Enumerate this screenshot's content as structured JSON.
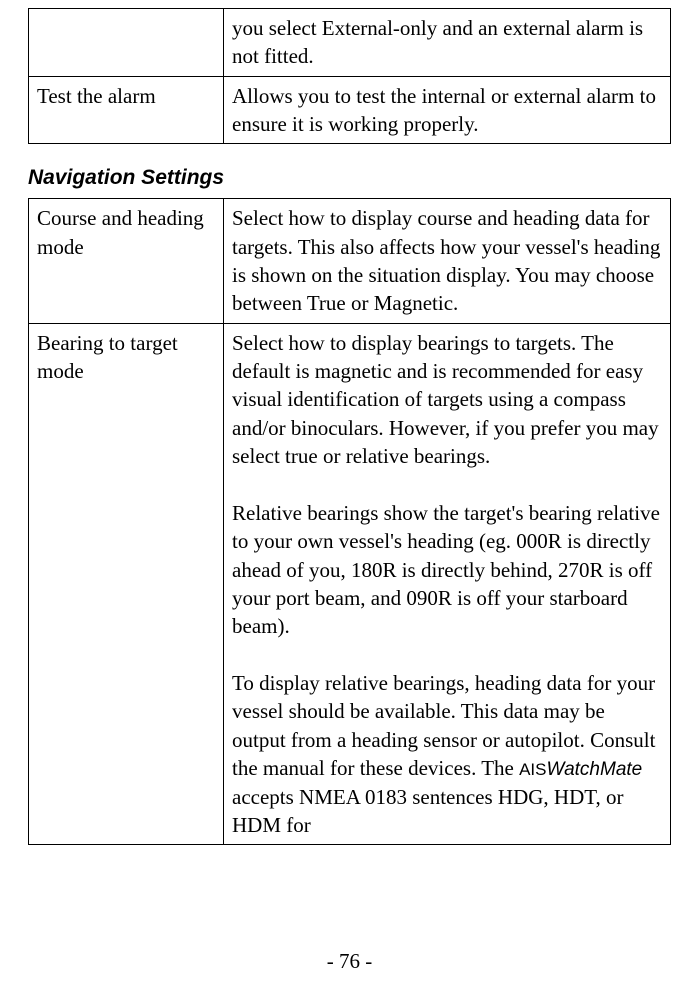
{
  "table1": {
    "row0": {
      "label": "",
      "desc": "you select External-only and an external alarm is not fitted."
    },
    "row1": {
      "label": "Test the alarm",
      "desc": "Allows you to test the internal or external alarm to ensure it is working properly."
    }
  },
  "section_heading": "Navigation Settings",
  "table2": {
    "row0": {
      "label": "Course and heading mode",
      "desc": "Select how to display course and heading data for targets. This also affects how your vessel's heading is shown on the situation display. You may choose between True or Magnetic."
    },
    "row1": {
      "label": "Bearing to target mode",
      "p1": "Select how to display bearings to targets. The default is magnetic and is recommended for easy visual identification of targets using a compass and/or binoculars. However, if you prefer you may select true or relative bearings.",
      "p2": "Relative bearings show the target's bearing relative to your own vessel's heading (eg. 000R is directly ahead of you, 180R is directly behind, 270R is off your port beam, and 090R is off your starboard beam).",
      "p3a": "To display relative bearings, heading data for your vessel should be available. This data may be output from a heading sensor or autopilot. Consult the manual for these devices. The ",
      "ais": "AIS",
      "wm": "WatchMate",
      "p3b": " accepts NMEA 0183 sentences HDG, HDT, or HDM for"
    }
  },
  "page_number": "- 76 -"
}
